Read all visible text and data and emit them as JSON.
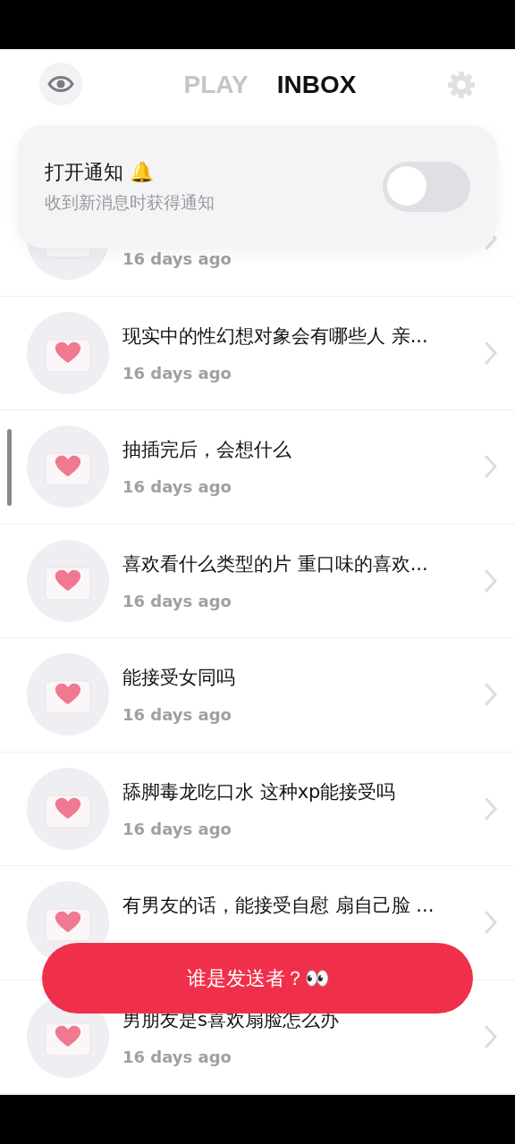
{
  "tabs": [
    {
      "label": "PLAY",
      "selected": false
    },
    {
      "label": "INBOX",
      "selected": true
    }
  ],
  "notification_card": {
    "title": "打开通知 🔔",
    "subtitle": "收到新消息时获得通知",
    "on": false
  },
  "messages": [
    {
      "time": "16 days ago"
    },
    {
      "text": "现实中的性幻想对象会有哪些人 亲...",
      "time": "16 days ago"
    },
    {
      "text": "抽插完后，会想什么",
      "time": "16 days ago"
    },
    {
      "text": "喜欢看什么类型的片 重口味的喜欢...",
      "time": "16 days ago"
    },
    {
      "text": "能接受女同吗",
      "time": "16 days ago"
    },
    {
      "text": "舔脚毒龙吃口水 这种xp能接受吗",
      "time": "16 days ago"
    },
    {
      "text": "有男友的话，能接受自慰 扇自己脸 ..."
    },
    {
      "text": "男朋友是s喜欢扇脸怎么办",
      "time": "16 days ago"
    }
  ],
  "reveal_button": {
    "label": "谁是发送者？👀"
  }
}
